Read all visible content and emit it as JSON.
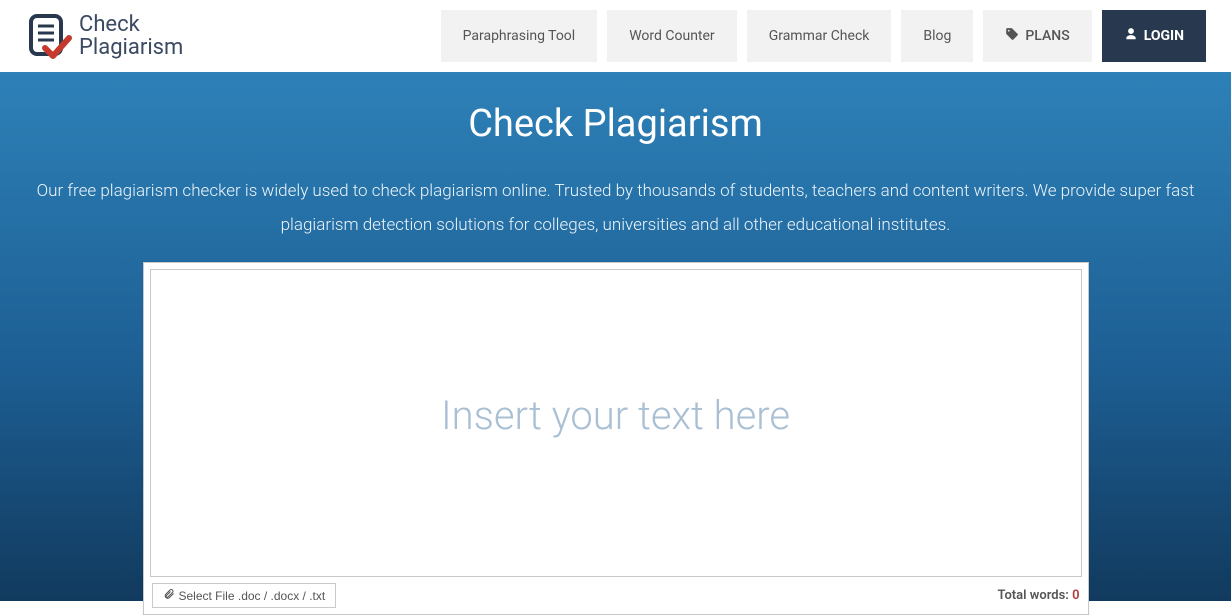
{
  "logo": {
    "line1": "Check",
    "line2": "Plagiarism"
  },
  "nav": {
    "items": [
      {
        "label": "Paraphrasing Tool"
      },
      {
        "label": "Word Counter"
      },
      {
        "label": "Grammar Check"
      },
      {
        "label": "Blog"
      }
    ],
    "plans_label": "PLANS",
    "login_label": "LOGIN"
  },
  "hero": {
    "title": "Check Plagiarism",
    "subtitle": "Our free plagiarism checker is widely used to check plagiarism online. Trusted by thousands of students, teachers and content writers. We provide super fast plagiarism detection solutions for colleges, universities and all other educational institutes."
  },
  "editor": {
    "placeholder": "Insert your text here",
    "value": "",
    "file_button_label": "Select File .doc / .docx / .txt",
    "total_words_label": "Total words:",
    "total_words_count": "0"
  }
}
